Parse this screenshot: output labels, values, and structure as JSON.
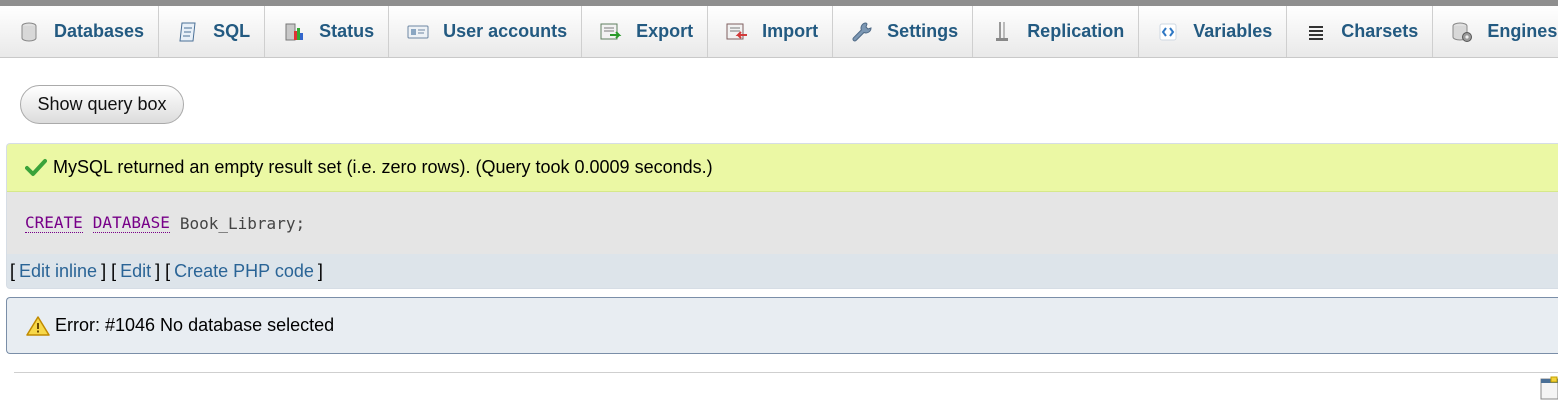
{
  "tabs": [
    {
      "label": "Databases",
      "icon": "database-icon"
    },
    {
      "label": "SQL",
      "icon": "sql-icon"
    },
    {
      "label": "Status",
      "icon": "status-icon"
    },
    {
      "label": "User accounts",
      "icon": "user-accounts-icon"
    },
    {
      "label": "Export",
      "icon": "export-icon"
    },
    {
      "label": "Import",
      "icon": "import-icon"
    },
    {
      "label": "Settings",
      "icon": "wrench-icon"
    },
    {
      "label": "Replication",
      "icon": "replication-icon"
    },
    {
      "label": "Variables",
      "icon": "variables-icon"
    },
    {
      "label": "Charsets",
      "icon": "charsets-icon"
    },
    {
      "label": "Engines",
      "icon": "engines-icon"
    }
  ],
  "tabs_more_icon": "chevron-down-icon",
  "query_box_button": "Show query box",
  "success": {
    "message": "MySQL returned an empty result set (i.e. zero rows). (Query took 0.0009 seconds.)",
    "icon": "checkmark-icon"
  },
  "sql": {
    "keyword1": "CREATE",
    "keyword2": "DATABASE",
    "rest": "Book_Library;"
  },
  "sql_links": {
    "open1": "[",
    "edit_inline": "Edit inline",
    "sep1": "] [",
    "edit": "Edit",
    "sep2": "] [",
    "create_php": "Create PHP code",
    "close": "]"
  },
  "error": {
    "message": "Error: #1046 No database selected",
    "icon": "warning-icon"
  },
  "colors": {
    "tab_text": "#235a81",
    "success_bg": "#ebf8a4",
    "sql_keyword": "#770088",
    "link": "#2a6496",
    "error_border": "#7a8ea8"
  }
}
